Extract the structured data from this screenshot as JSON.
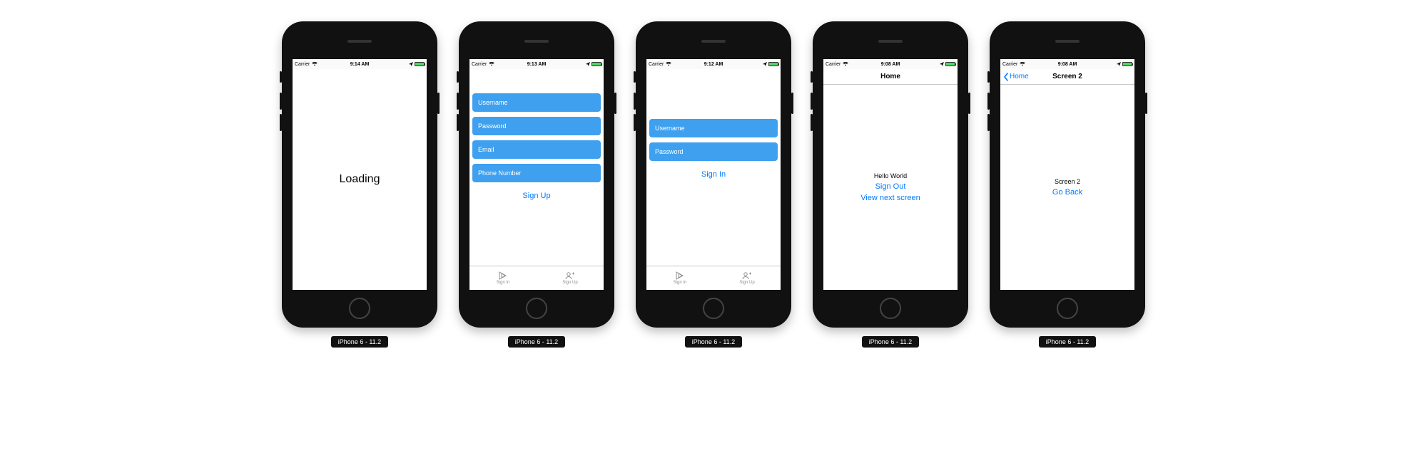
{
  "sim_label": "iPhone 6 - 11.2",
  "carrier": "Carrier",
  "screens": [
    {
      "time": "9:14 AM",
      "loading_text": "Loading"
    },
    {
      "time": "9:13 AM",
      "fields": {
        "username": "Username",
        "password": "Password",
        "email": "Email",
        "phone": "Phone Number"
      },
      "action": "Sign Up",
      "tabs": {
        "signin": "Sign In",
        "signup": "Sign Up"
      }
    },
    {
      "time": "9:12 AM",
      "fields": {
        "username": "Username",
        "password": "Password"
      },
      "action": "Sign In",
      "tabs": {
        "signin": "Sign In",
        "signup": "Sign Up"
      }
    },
    {
      "time": "9:08 AM",
      "nav_title": "Home",
      "hello": "Hello World",
      "signout": "Sign Out",
      "next": "View next screen"
    },
    {
      "time": "9:08 AM",
      "nav_title": "Screen 2",
      "nav_back": "Home",
      "body_title": "Screen 2",
      "goback": "Go Back"
    }
  ]
}
